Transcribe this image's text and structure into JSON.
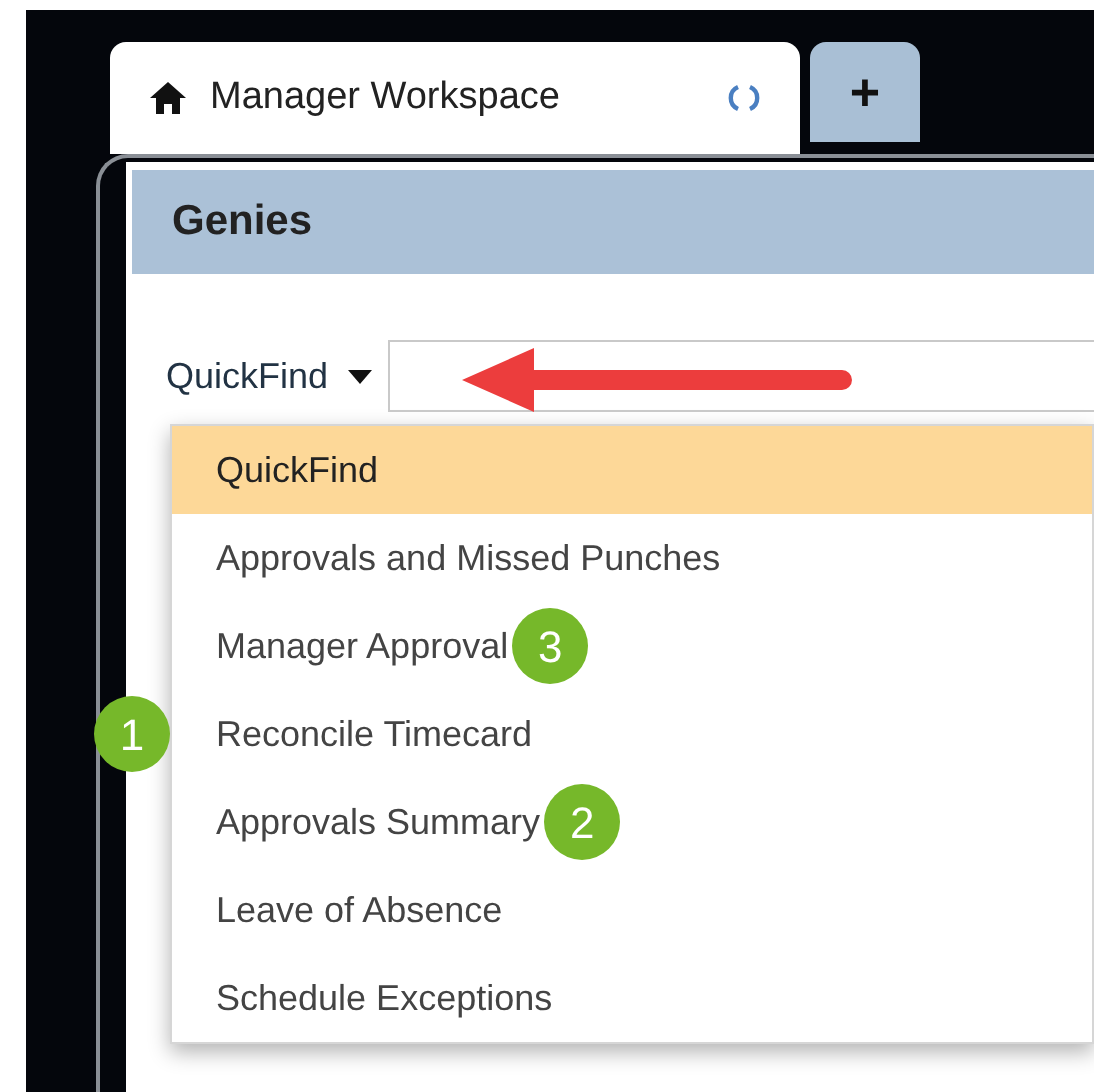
{
  "tabs": [
    {
      "label": "Manager Workspace",
      "kind": "page",
      "selected": true
    },
    {
      "label": "+",
      "kind": "add",
      "selected": false
    }
  ],
  "panel": {
    "title": "Genies"
  },
  "quickfind": {
    "label": "QuickFind",
    "expanded": true
  },
  "menu": [
    {
      "label": "QuickFind",
      "selected": true
    },
    {
      "label": "Approvals and Missed Punches",
      "selected": false
    },
    {
      "label": "Manager Approval",
      "selected": false,
      "callout": "3",
      "callout_before": false
    },
    {
      "label": "Reconcile Timecard",
      "selected": false,
      "callout": "1",
      "callout_before": true
    },
    {
      "label": "Approvals Summary",
      "selected": false,
      "callout": "2",
      "callout_before": false
    },
    {
      "label": "Leave of Absence",
      "selected": false
    },
    {
      "label": "Schedule Exceptions",
      "selected": false
    }
  ]
}
